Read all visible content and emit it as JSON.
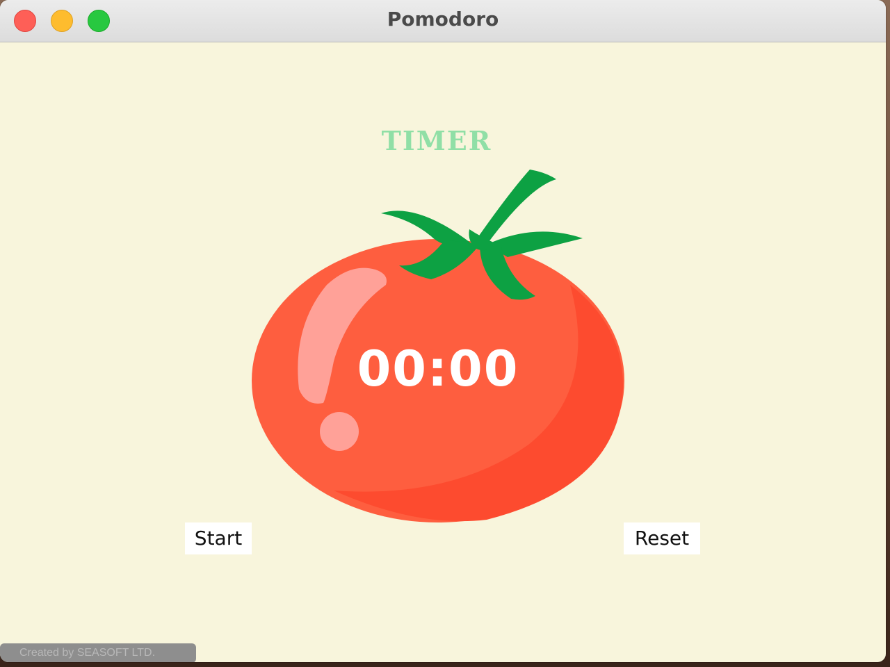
{
  "window": {
    "title": "Pomodoro"
  },
  "timer": {
    "label": "TIMER",
    "display": "00:00"
  },
  "controls": {
    "start_label": "Start",
    "reset_label": "Reset"
  },
  "footer": {
    "credit": "Created by SEASOFT LTD."
  },
  "icons": {
    "tomato": "tomato-icon",
    "close": "close-icon",
    "minimize": "minimize-icon",
    "maximize": "maximize-icon"
  },
  "colors": {
    "background": "#f8f5dc",
    "timer_label": "#90dfa6",
    "tomato": "#fe5e3f",
    "leaves": "#0da143",
    "time_text": "#ffffff"
  }
}
